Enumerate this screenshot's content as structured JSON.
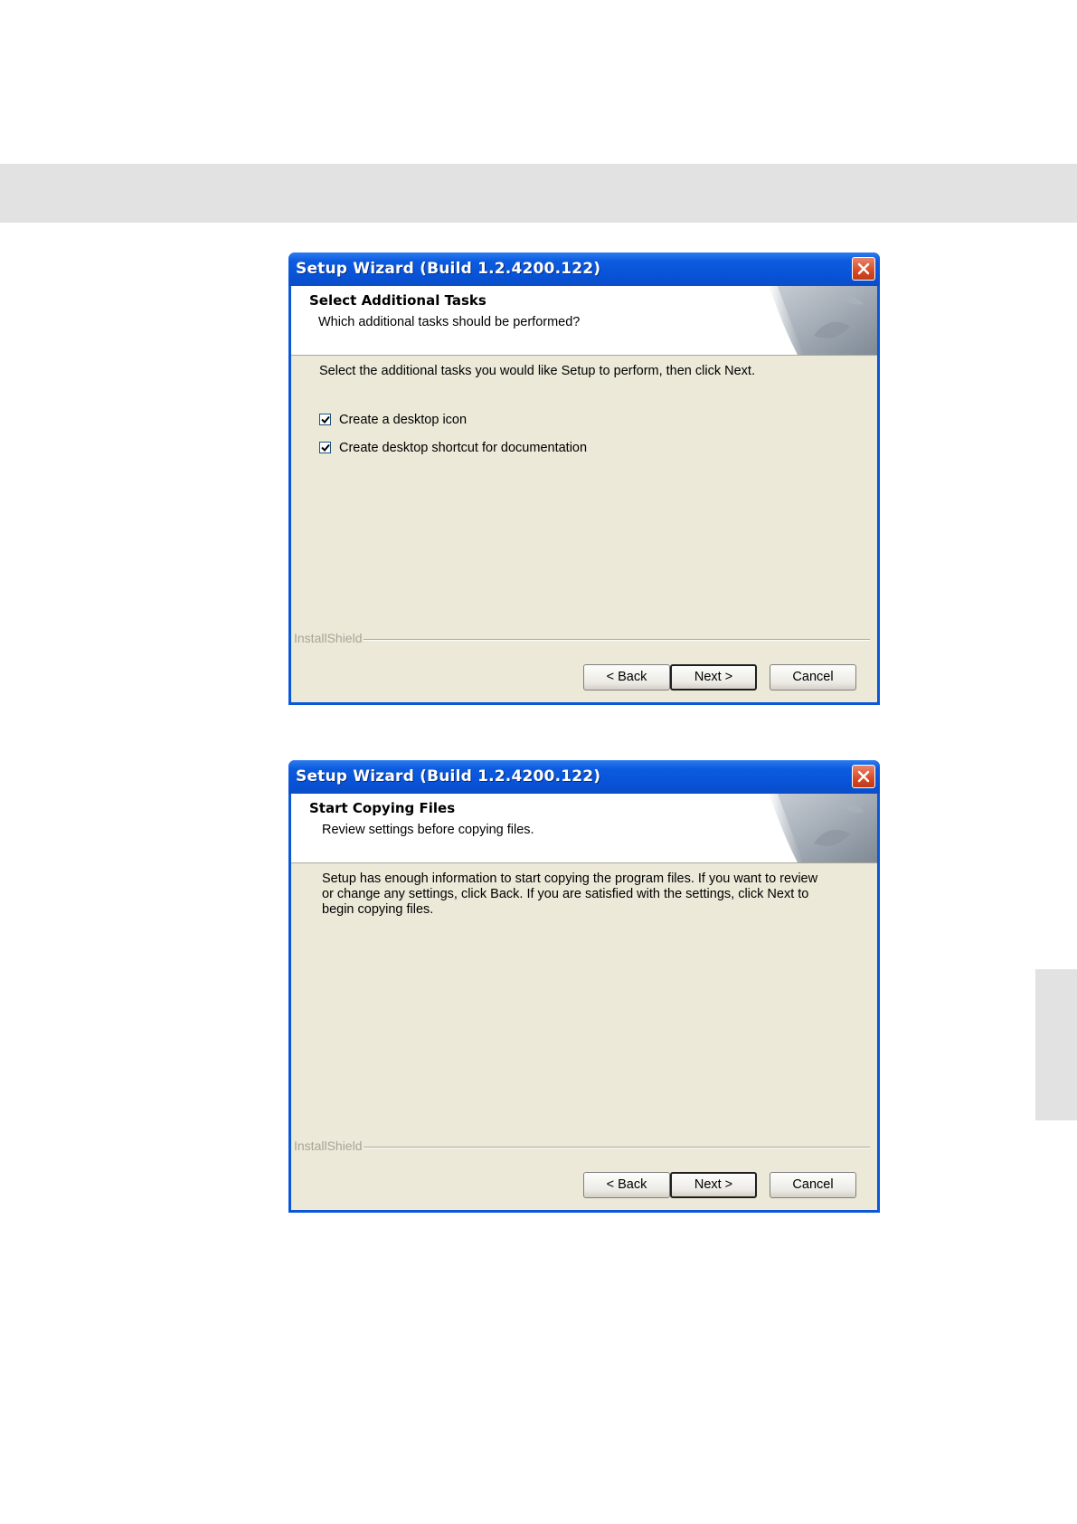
{
  "wizards": [
    {
      "title": "Setup Wizard (Build 1.2.4200.122)",
      "header_title": "Select Additional Tasks",
      "header_subtitle": "Which additional tasks should be performed?",
      "instruction": "Select the additional tasks you would like Setup to perform, then click Next.",
      "checkboxes": [
        {
          "label": "Create a desktop icon",
          "checked": true
        },
        {
          "label": "Create desktop shortcut for documentation",
          "checked": true
        }
      ],
      "brand": "InstallShield",
      "buttons": {
        "back": "< Back",
        "next": "Next >",
        "cancel": "Cancel"
      }
    },
    {
      "title": "Setup Wizard (Build 1.2.4200.122)",
      "header_title": "Start Copying Files",
      "header_subtitle": "Review settings before copying files.",
      "body": "Setup has enough information to start copying the program files.  If you want to review or change any settings, click Back.  If you are satisfied with the settings, click Next to begin copying files.",
      "brand": "InstallShield",
      "buttons": {
        "back": "< Back",
        "next": "Next >",
        "cancel": "Cancel"
      }
    }
  ],
  "colors": {
    "titlebar": "#0a57d8",
    "client_bg": "#ece9d8",
    "close_button": "#d84a25",
    "page_band": "#e2e2e2"
  },
  "icons": {
    "close": "close-icon",
    "checkmark": "checkmark-icon",
    "header_graphic": "page-curl-graphic"
  }
}
